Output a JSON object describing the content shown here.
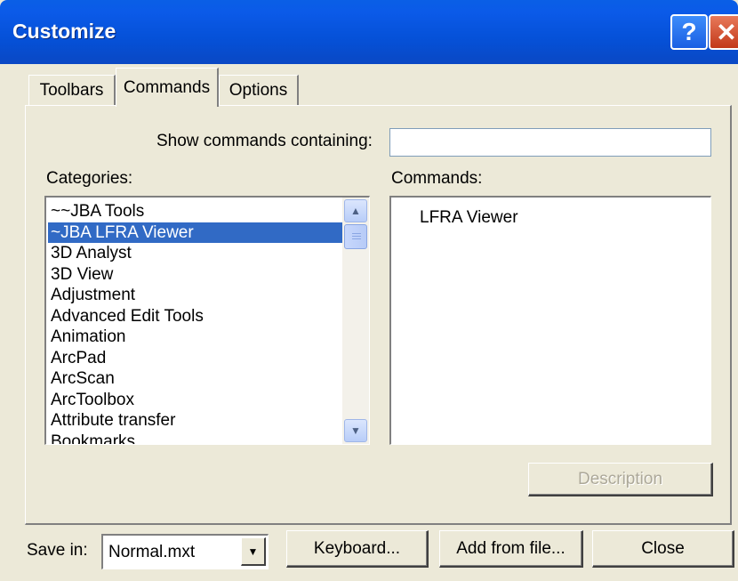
{
  "window": {
    "title": "Customize",
    "help_glyph": "?",
    "close_glyph": "✕"
  },
  "tabs": [
    {
      "label": "Toolbars",
      "active": false
    },
    {
      "label": "Commands",
      "active": true
    },
    {
      "label": "Options",
      "active": false
    }
  ],
  "search": {
    "label": "Show commands containing:",
    "value": ""
  },
  "categories": {
    "label": "Categories:",
    "selected": "~JBA LFRA Viewer",
    "items": [
      "~~JBA Tools",
      "~JBA LFRA Viewer",
      "3D Analyst",
      "3D View",
      "Adjustment",
      "Advanced Edit Tools",
      "Animation",
      "ArcPad",
      "ArcScan",
      "ArcToolbox",
      "Attribute transfer",
      "Bookmarks"
    ]
  },
  "commands": {
    "label": "Commands:",
    "items": [
      "LFRA Viewer"
    ]
  },
  "description_button": "Description",
  "footer": {
    "save_in_label": "Save in:",
    "save_in_value": "Normal.mxt",
    "keyboard_button": "Keyboard...",
    "add_from_file_button": "Add from file...",
    "close_button": "Close"
  },
  "icons": {
    "help": "help-icon",
    "close": "close-icon",
    "scroll_up": "arrow-up-icon",
    "scroll_down": "arrow-down-icon",
    "dropdown": "chevron-down-icon"
  },
  "colors": {
    "titlebar": "#0a5fe6",
    "selection": "#316ac5",
    "dialog_bg": "#ece9d8"
  }
}
